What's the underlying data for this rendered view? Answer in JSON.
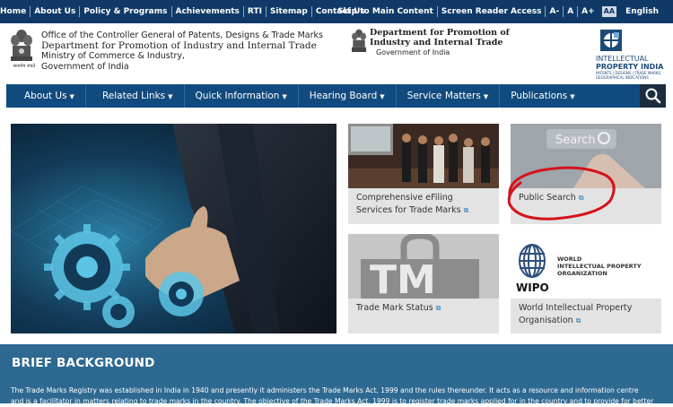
{
  "topbar": {
    "links": [
      "Home",
      "About Us",
      "Policy & Programs",
      "Achievements",
      "RTI",
      "Sitemap",
      "Contact Us"
    ],
    "right": {
      "skip": "Skip to Main Content",
      "screen_reader": "Screen Reader Access",
      "font_minus": "A-",
      "font_normal": "A",
      "font_plus": "A+",
      "contrast": "AA",
      "language": "English"
    }
  },
  "header": {
    "office_line1": "Office of the Controller General of Patents, Designs & Trade Marks",
    "office_line2": "Department for Promotion of Industry and Internal Trade",
    "office_line3": "Ministry of Commerce & Industry,",
    "office_line4": "Government of India",
    "emblem_caption": "सत्यमेव जयते",
    "dept_line1": "Department for Promotion of",
    "dept_line2": "Industry and Internal Trade",
    "dept_line3": "Government of India",
    "ip_line1": "INTELLECTUAL",
    "ip_line2": "PROPERTY INDIA",
    "ip_line3": "PATENTS | DESIGNS | TRADE MARKS",
    "ip_line4": "GEOGRAPHICAL INDICATIONS"
  },
  "nav": {
    "items": [
      "About Us",
      "Related Links",
      "Quick Information",
      "Hearing Board",
      "Service Matters",
      "Publications"
    ]
  },
  "cards": {
    "efiling": "Comprehensive eFiling Services for Trade Marks",
    "search": "Public Search",
    "search_image_text": "Search",
    "tm_status": "Trade Mark Status",
    "tm_image_text": "TM",
    "wipo": "World Intellectual Property Organisation",
    "wipo_logo_line1": "WORLD",
    "wipo_logo_line2": "INTELLECTUAL PROPERTY",
    "wipo_logo_line3": "ORGANIZATION",
    "wipo_logo_abbr": "WIPO"
  },
  "brief": {
    "title": "BRIEF BACKGROUND",
    "line1": "The Trade Marks Registry was established in India in 1940 and presently it administers the Trade Marks Act, 1999 and the rules thereunder. It acts as a resource and information centre",
    "line2": "and is a facilitator in matters relating to trade marks in the country. The objective of the Trade Marks Act, 1999 is to register trade marks applied for in the country and to provide for better"
  },
  "colors": {
    "topbar": "#0f3a67",
    "nav": "#114a7e",
    "brief": "#2e6991",
    "annotation_circle": "#d4131b"
  }
}
